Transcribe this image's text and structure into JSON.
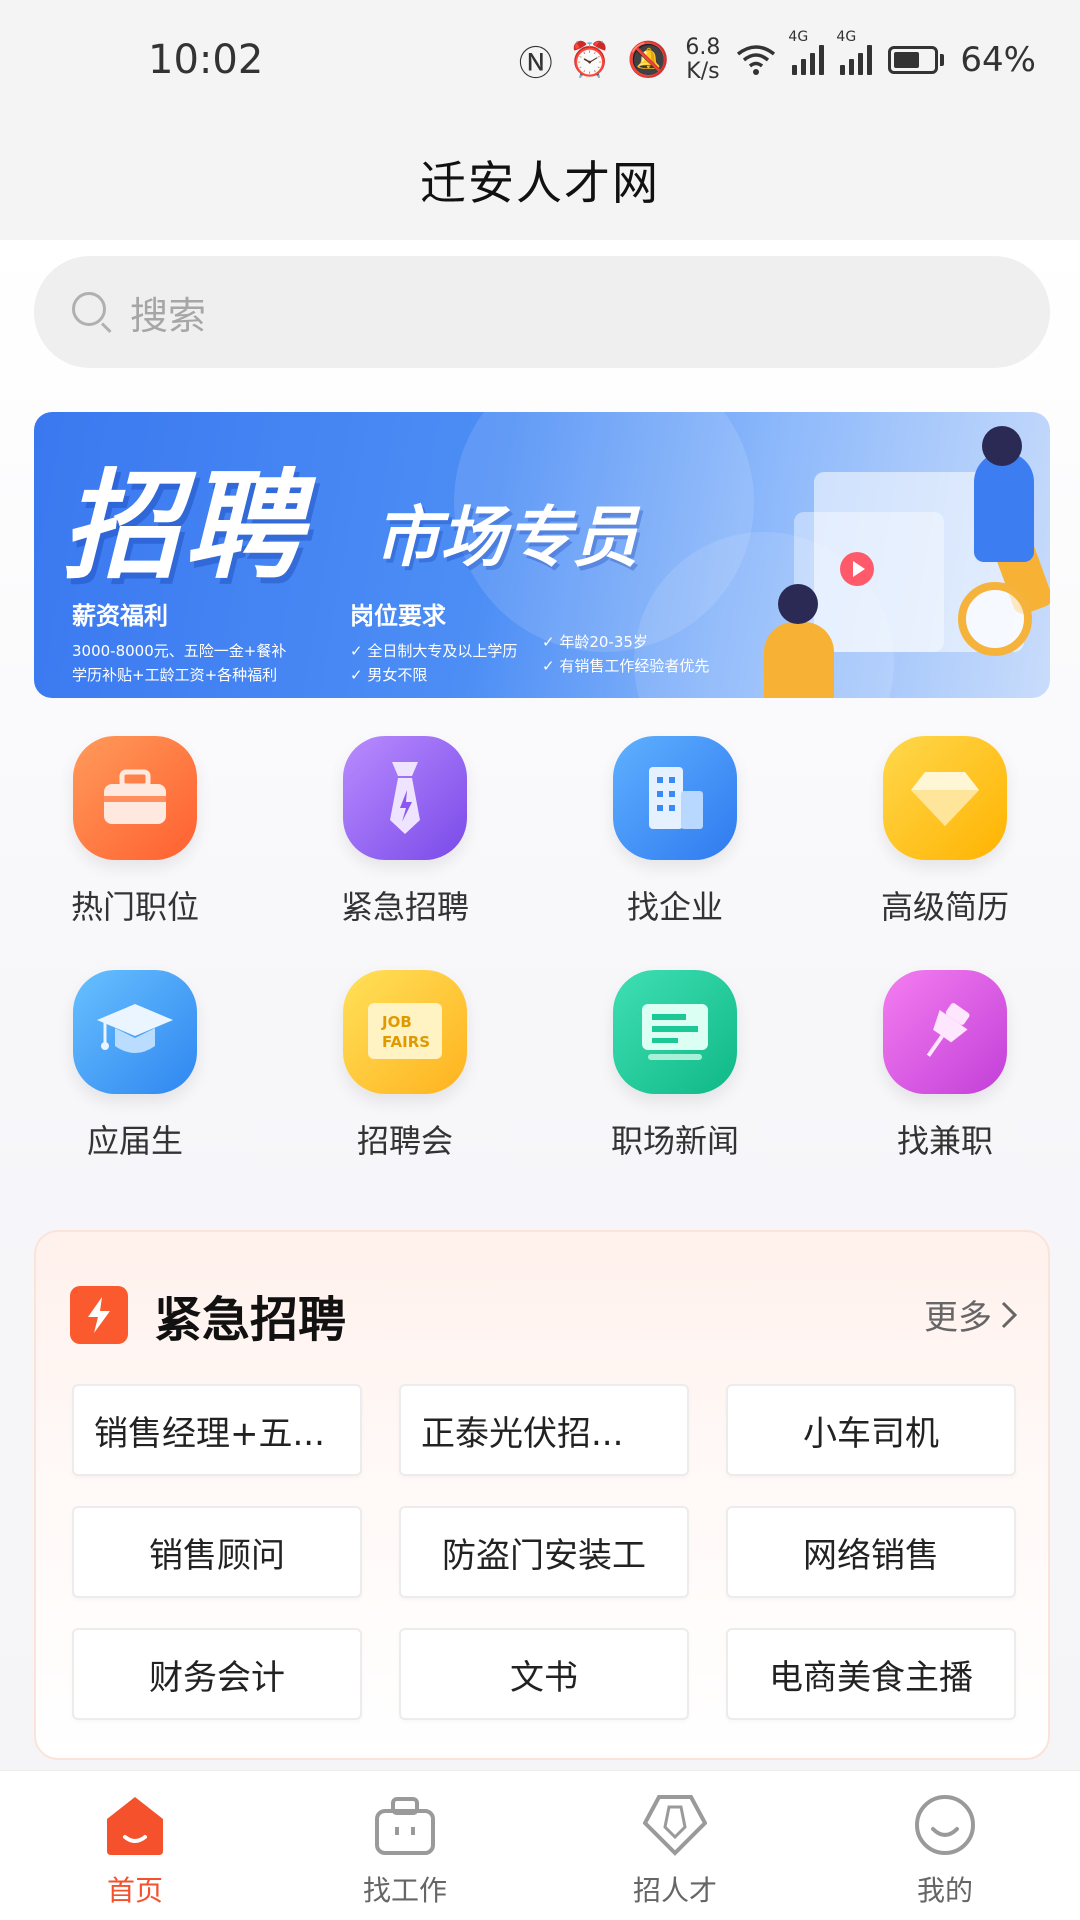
{
  "status_bar": {
    "time": "10:02",
    "net_speed_value": "6.8",
    "net_speed_unit": "K/s",
    "network_tag_1": "4G",
    "network_tag_2": "4G",
    "battery": "64%",
    "battery_level": 0.64
  },
  "header": {
    "title": "迁安人才网"
  },
  "search": {
    "placeholder": "搜索"
  },
  "banner": {
    "headline": "招聘",
    "position": "市场专员",
    "salary_title": "薪资福利",
    "salary_line1": "3000-8000元、五险一金+餐补",
    "salary_line2": "学历补贴+工龄工资+各种福利",
    "req_title": "岗位要求",
    "req_line1": "✓ 全日制大专及以上学历",
    "req_line2": "✓ 男女不限",
    "req_line3": "✓ 年龄20-35岁",
    "req_line4": "✓ 有销售工作经验者优先"
  },
  "quick_menu": [
    {
      "label": "热门职位",
      "icon": "briefcase-icon",
      "color": "#ff6f3c"
    },
    {
      "label": "紧急招聘",
      "icon": "tie-icon",
      "color": "#8e5cf0"
    },
    {
      "label": "找企业",
      "icon": "building-icon",
      "color": "#3b8af4"
    },
    {
      "label": "高级简历",
      "icon": "diamond-icon",
      "color": "#ffc21e"
    },
    {
      "label": "应届生",
      "icon": "graduation-cap-icon",
      "color": "#3b94f5"
    },
    {
      "label": "招聘会",
      "icon": "job-fairs-icon",
      "color": "#ffc52a",
      "icon_text_1": "JOB",
      "icon_text_2": "FAIRS"
    },
    {
      "label": "职场新闻",
      "icon": "news-icon",
      "color": "#1cc895"
    },
    {
      "label": "找兼职",
      "icon": "pushpin-icon",
      "color": "#d454e2"
    }
  ],
  "urgent": {
    "title": "紧急招聘",
    "more": "更多",
    "jobs": [
      "销售经理+五...",
      "正泰光伏招...",
      "小车司机",
      "销售顾问",
      "防盗门安装工",
      "网络销售",
      "财务会计",
      "文书",
      "电商美食主播"
    ]
  },
  "bottom_nav": [
    {
      "label": "首页",
      "active": true
    },
    {
      "label": "找工作",
      "active": false
    },
    {
      "label": "招人才",
      "active": false
    },
    {
      "label": "我的",
      "active": false
    }
  ],
  "colors": {
    "accent": "#f4512c",
    "inactive": "#9a9a9a"
  }
}
